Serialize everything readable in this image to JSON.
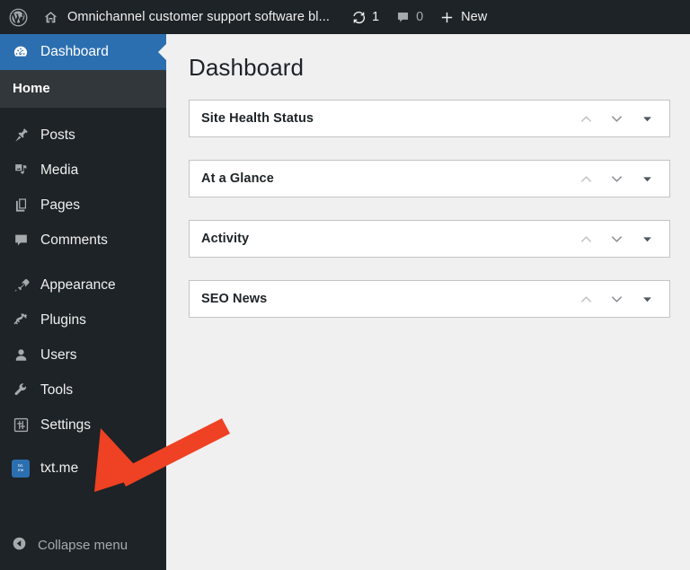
{
  "adminbar": {
    "wp_logo_icon": "wordpress-logo-icon",
    "home_icon": "home-icon",
    "site_title": "Omnichannel customer support software bl...",
    "updates_icon": "updates-icon",
    "updates_count": "1",
    "comments_icon": "comment-bubble-icon",
    "comments_count": "0",
    "new_icon": "plus-icon",
    "new_label": "New"
  },
  "sidebar": {
    "current": {
      "icon": "dashboard-gauge-icon",
      "label": "Dashboard"
    },
    "submenu": [
      {
        "label": "Home"
      }
    ],
    "group1": [
      {
        "icon": "pin-icon",
        "label": "Posts"
      },
      {
        "icon": "media-icon",
        "label": "Media"
      },
      {
        "icon": "pages-icon",
        "label": "Pages"
      },
      {
        "icon": "comments-icon",
        "label": "Comments"
      }
    ],
    "group2": [
      {
        "icon": "paintbrush-icon",
        "label": "Appearance"
      },
      {
        "icon": "plug-icon",
        "label": "Plugins"
      },
      {
        "icon": "user-icon",
        "label": "Users"
      },
      {
        "icon": "wrench-icon",
        "label": "Tools"
      },
      {
        "icon": "sliders-icon",
        "label": "Settings"
      }
    ],
    "plugin": {
      "icon": "txtme-plugin-icon",
      "icon_text_1": "txt.",
      "icon_text_2": "me",
      "label": "txt.me"
    },
    "collapse": {
      "icon": "collapse-arrow-icon",
      "label": "Collapse menu"
    }
  },
  "main": {
    "page_title": "Dashboard",
    "panels": [
      {
        "title": "Site Health Status"
      },
      {
        "title": "At a Glance"
      },
      {
        "title": "Activity"
      },
      {
        "title": "SEO News"
      }
    ],
    "panel_actions": {
      "up_icon": "chevron-up-icon",
      "down_icon": "chevron-down-icon",
      "toggle_icon": "triangle-down-icon"
    }
  },
  "annotation": {
    "arrow_icon": "red-pointer-arrow",
    "color": "#ef4123"
  },
  "colors": {
    "sidebar_bg": "#1d2327",
    "submenu_bg": "#32373c",
    "accent_blue": "#2c6fb0",
    "content_bg": "#f0f0f1",
    "panel_border": "#c3c4c7",
    "text_dark": "#1d2327",
    "annotation_red": "#ef4123"
  }
}
